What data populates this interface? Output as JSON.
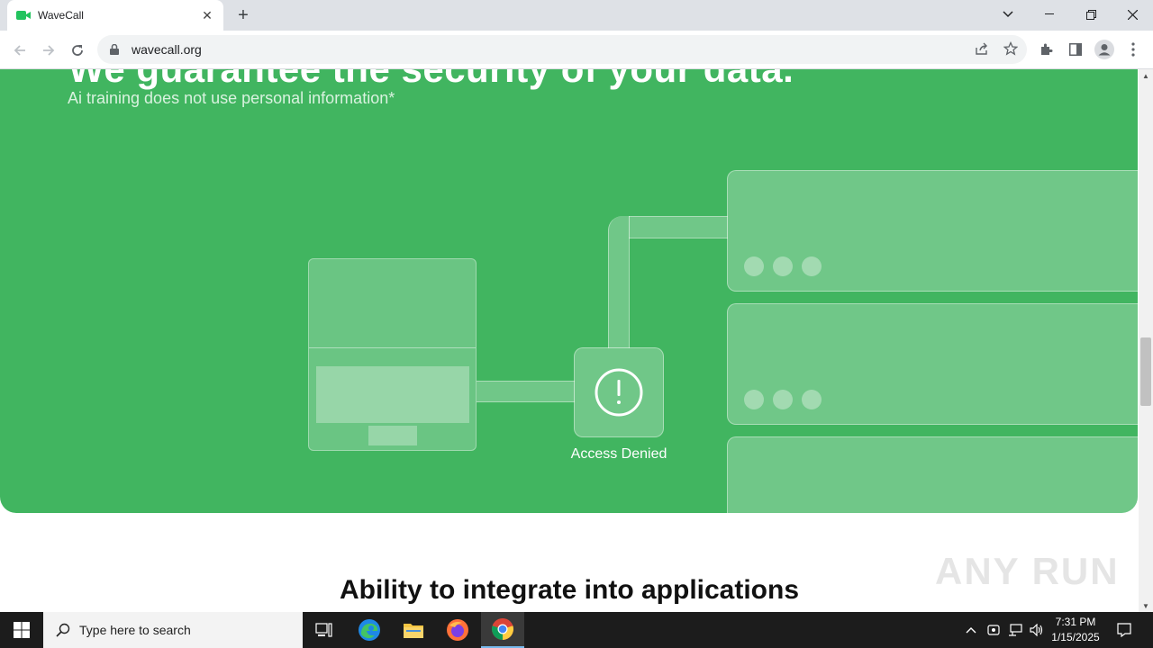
{
  "browser": {
    "tab_title": "WaveCall",
    "url": "wavecall.org",
    "accent": "#1a73e8"
  },
  "hero": {
    "title": "We guarantee the security of your data.",
    "subtitle": "Ai training does not use personal information*",
    "alert_label": "Access Denied",
    "bg_color": "#41b560"
  },
  "section": {
    "title": "Ability to integrate into applications"
  },
  "watermark": "ANY RUN",
  "taskbar": {
    "search_placeholder": "Type here to search",
    "time": "7:31 PM",
    "date": "1/15/2025"
  }
}
